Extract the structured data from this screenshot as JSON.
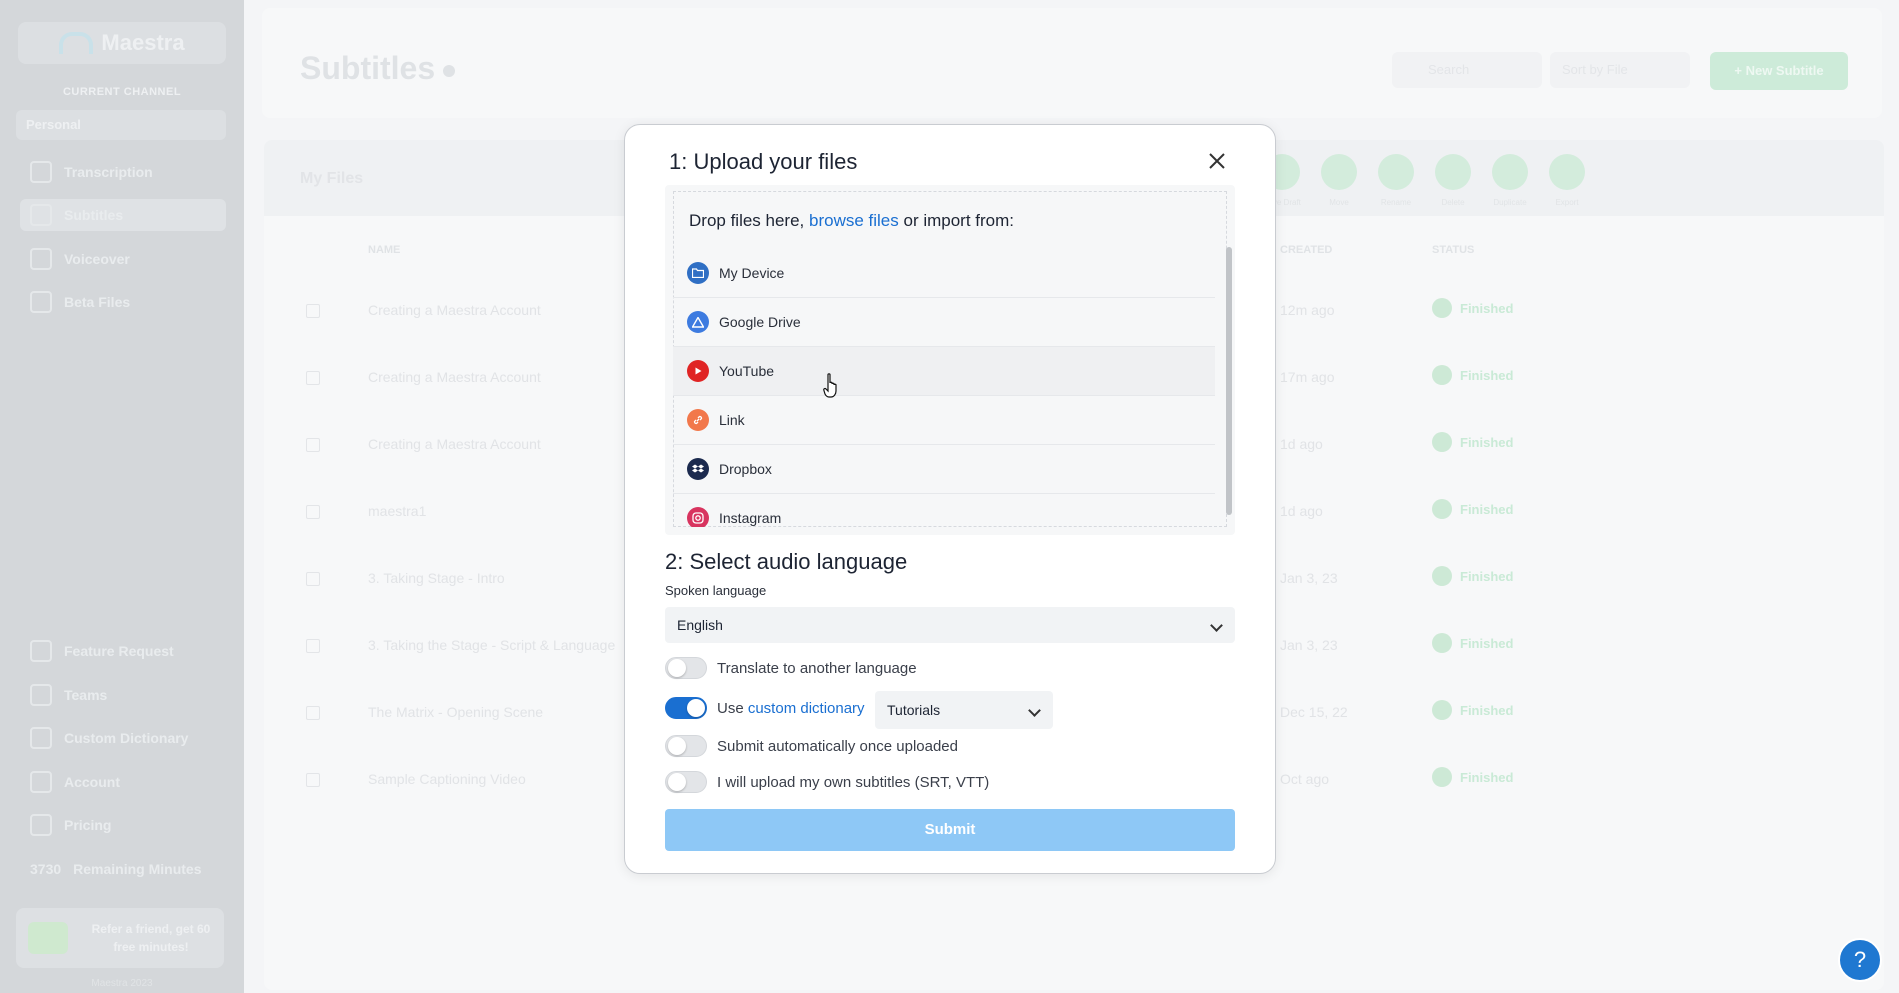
{
  "app": {
    "name": "Maestra",
    "version": "Maestra 2023"
  },
  "sidebar": {
    "channel_caption": "CURRENT CHANNEL",
    "channel_value": "Personal",
    "items": [
      {
        "label": "Transcription"
      },
      {
        "label": "Subtitles"
      },
      {
        "label": "Voiceover"
      },
      {
        "label": "Beta Files"
      }
    ],
    "bottom_items": [
      {
        "label": "Feature Request"
      },
      {
        "label": "Teams"
      },
      {
        "label": "Custom Dictionary"
      },
      {
        "label": "Account"
      },
      {
        "label": "Pricing"
      },
      {
        "label": "Remaining Minutes",
        "value": "3730"
      }
    ],
    "refer_text": "Refer a friend, get 60 free minutes!"
  },
  "header": {
    "title": "Subtitles",
    "search_placeholder": "Search",
    "sort_label": "Sort by File",
    "new_button": "+ New Subtitle"
  },
  "files": {
    "title": "My Files",
    "tools": [
      "Save Draft",
      "Move",
      "Rename",
      "Delete",
      "Duplicate",
      "Export"
    ],
    "columns": {
      "name": "NAME",
      "date": "CREATED",
      "status": "STATUS"
    },
    "rows": [
      {
        "name": "Creating a Maestra Account",
        "date": "12m ago",
        "status": "Finished"
      },
      {
        "name": "Creating a Maestra Account",
        "date": "17m ago",
        "status": "Finished"
      },
      {
        "name": "Creating a Maestra Account",
        "date": "1d ago",
        "status": "Finished"
      },
      {
        "name": "maestra1",
        "date": "1d ago",
        "status": "Finished"
      },
      {
        "name": "3. Taking Stage - Intro",
        "date": "Jan 3, 23",
        "status": "Finished"
      },
      {
        "name": "3. Taking the Stage - Script & Language",
        "date": "Jan 3, 23",
        "status": "Finished"
      },
      {
        "name": "The Matrix - Opening Scene",
        "date": "Dec 15, 22",
        "status": "Finished"
      },
      {
        "name": "Sample Captioning Video",
        "date": "Oct ago",
        "status": "Finished"
      }
    ]
  },
  "modal": {
    "step1_title": "1: Upload your files",
    "drop_prefix": "Drop files here, ",
    "drop_link": "browse files",
    "drop_suffix": " or import from:",
    "sources": [
      {
        "label": "My Device",
        "icon": "folder-icon",
        "color": "#2f6fc4"
      },
      {
        "label": "Google Drive",
        "icon": "google-drive-icon",
        "color": "#3d7be0"
      },
      {
        "label": "YouTube",
        "icon": "youtube-icon",
        "color": "#e02424"
      },
      {
        "label": "Link",
        "icon": "link-icon",
        "color": "#f2784b"
      },
      {
        "label": "Dropbox",
        "icon": "dropbox-icon",
        "color": "#1b2a4e"
      },
      {
        "label": "Instagram",
        "icon": "instagram-icon",
        "color": "#d8345f"
      }
    ],
    "step2_title": "2: Select audio language",
    "spoken_language_label": "Spoken language",
    "spoken_language_value": "English",
    "options": {
      "translate": {
        "label": "Translate to another language",
        "on": false
      },
      "dictionary": {
        "prefix": "Use ",
        "link": "custom dictionary",
        "on": true,
        "value": "Tutorials"
      },
      "auto_submit": {
        "label": "Submit automatically once uploaded",
        "on": false
      },
      "own_subtitles": {
        "label": "I will upload my own subtitles (SRT, VTT)",
        "on": false
      }
    },
    "submit_label": "Submit"
  },
  "colors": {
    "accent": "#1a6fd1",
    "submit_disabled": "#8ec8f6",
    "help": "#1f78d1"
  }
}
